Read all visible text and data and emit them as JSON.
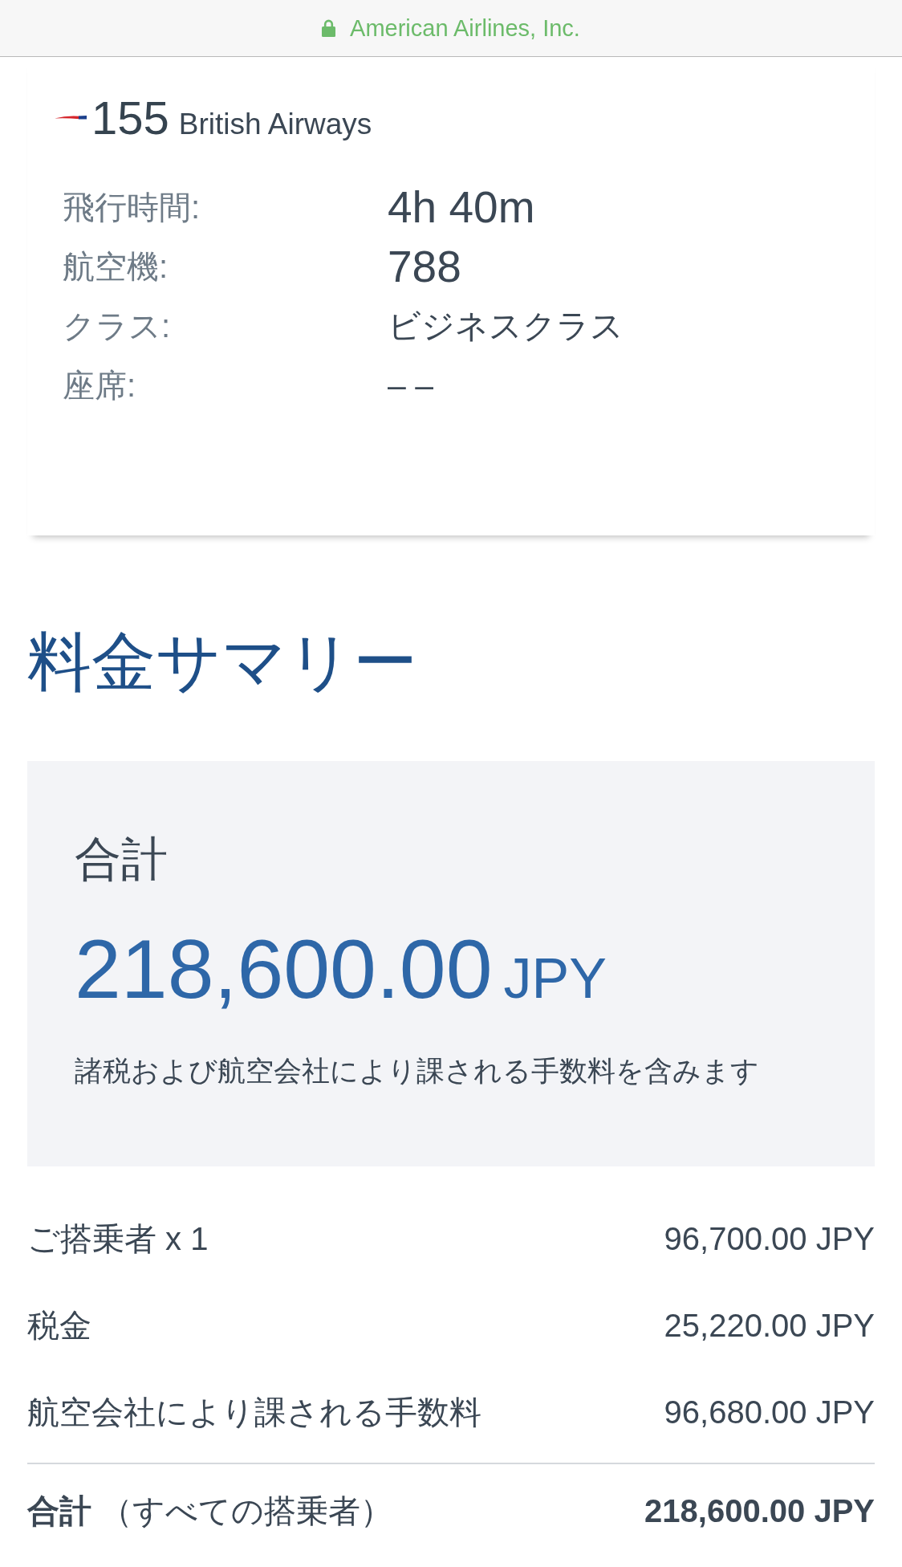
{
  "address_bar": {
    "site_name": "American Airlines, Inc.",
    "secure": true
  },
  "flight": {
    "number": "155",
    "airline": "British Airways",
    "details": [
      {
        "label": "飛行時間:",
        "value": "4h 40m",
        "kind": "numeric"
      },
      {
        "label": "航空機:",
        "value": "788",
        "kind": "numeric"
      },
      {
        "label": "クラス:",
        "value": "ビジネスクラス",
        "kind": "text"
      },
      {
        "label": "座席:",
        "value": "– –",
        "kind": "text"
      }
    ]
  },
  "fare_summary": {
    "title": "料金サマリー",
    "total_box": {
      "label": "合計",
      "amount": "218,600.00",
      "currency": "JPY",
      "note": "諸税および航空会社により課される手数料を含みます"
    },
    "breakdown": [
      {
        "label": "ご搭乗者 x 1",
        "amount": "96,700.00 JPY"
      },
      {
        "label": "税金",
        "amount": "25,220.00 JPY"
      },
      {
        "label": "航空会社により課される手数料",
        "amount": "96,680.00 JPY"
      }
    ],
    "grand_total": {
      "label": "**合計** （すべての搭乗者）",
      "amount": "218,600.00 JPY"
    }
  }
}
